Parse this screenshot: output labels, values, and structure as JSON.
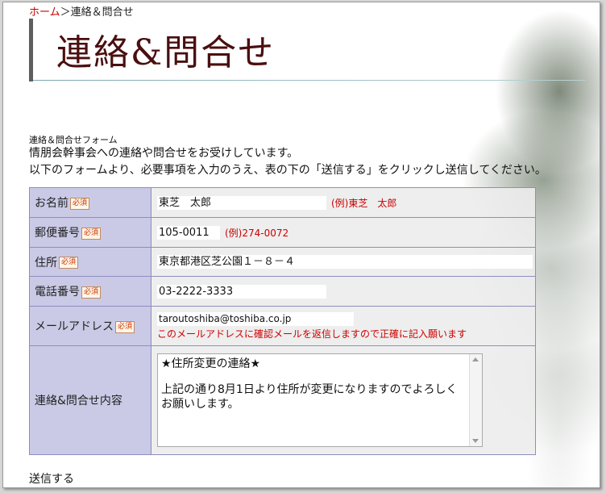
{
  "breadcrumb": {
    "home": "ホーム",
    "separator": "＞",
    "current": "連絡＆問合せ"
  },
  "page_title": "連絡&問合せ",
  "form_label": "連絡＆問合せフォーム",
  "description": {
    "line1": "情朋会幹事会への連絡や問合せをお受けしています。",
    "line2": "以下のフォームより、必要事項を入力のうえ、表の下の「送信する」をクリックし送信してください。"
  },
  "required_badge": "必須",
  "fields": {
    "name": {
      "label": "お名前",
      "value": "東芝　太郎",
      "example": "(例)東芝　太郎"
    },
    "postal": {
      "label": "郵便番号",
      "value": "105-0011",
      "example": "(例)274-0072"
    },
    "address": {
      "label": "住所",
      "value": "東京都港区芝公園１－８－４"
    },
    "phone": {
      "label": "電話番号",
      "value": "03-2222-3333"
    },
    "email": {
      "label": "メールアドレス",
      "value": "taroutoshiba@toshiba.co.jp",
      "note": "このメールアドレスに確認メールを返信しますので正確に記入願います"
    },
    "message": {
      "label": "連絡&問合せ内容",
      "line1": "★住所変更の連絡★",
      "line2": "",
      "line3": "上記の通り8月1日より住所が変更になりますのでよろしくお願いします。"
    }
  },
  "submit_label": "送信する",
  "colors": {
    "label_bg": "#c6c6e4",
    "border": "#8e8ebf",
    "accent_red": "#cc0000",
    "title": "#4a0f0f"
  }
}
